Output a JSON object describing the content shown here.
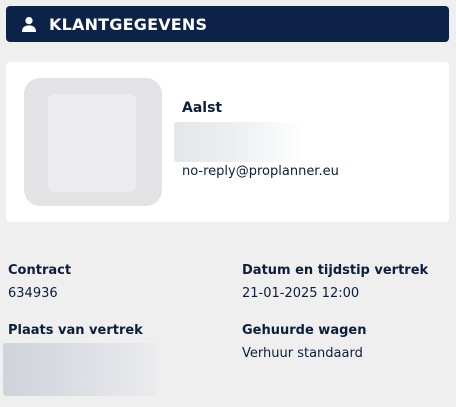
{
  "header": {
    "icon": "user-icon",
    "title": "KLANTGEGEVENS"
  },
  "customer": {
    "avatar_icon": "avatar-placeholder",
    "name": "Aalst",
    "email": "no-reply@proplanner.eu"
  },
  "details": {
    "contract": {
      "label": "Contract",
      "value": "634936"
    },
    "departure_datetime": {
      "label": "Datum en tijdstip vertrek",
      "value": "21-01-2025 12:00"
    },
    "departure_place": {
      "label": "Plaats van vertrek"
    },
    "rented_vehicle": {
      "label": "Gehuurde wagen",
      "value": "Verhuur standaard"
    }
  },
  "colors": {
    "header_bg": "#0c2347",
    "header_text": "#ffffff",
    "page_bg": "#efefef",
    "card_bg": "#ffffff",
    "text": "#0b1f3a"
  }
}
